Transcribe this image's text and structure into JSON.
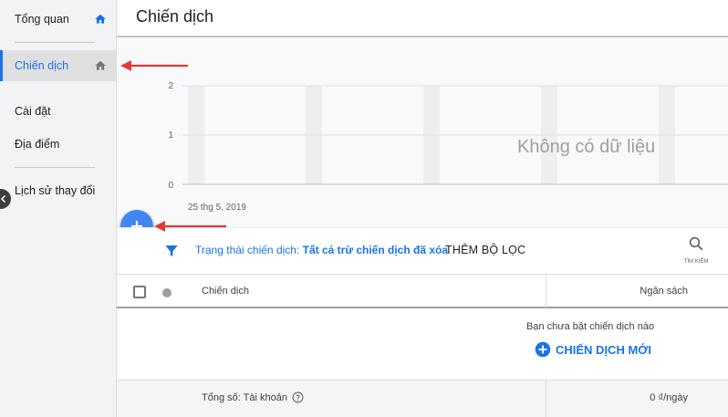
{
  "sidebar": {
    "items": [
      {
        "label": "Tổng quan",
        "icon": "home-icon"
      },
      {
        "label": "Chiến dịch",
        "icon": "home-icon",
        "active": true
      },
      {
        "label": "Cài đặt"
      },
      {
        "label": "Địa điểm"
      },
      {
        "label": "Lịch sử thay đổi"
      }
    ]
  },
  "header": {
    "title": "Chiến dịch"
  },
  "chart": {
    "y_ticks": [
      "2",
      "1",
      "0"
    ],
    "x_label": "25 thg 5, 2019",
    "no_data": "Không có dữ liệu"
  },
  "filter": {
    "label": "Trạng thái chiến dịch:",
    "value": "Tất cả trừ chiến dịch đã xóa",
    "add_filter": "THÊM BỘ LỌC",
    "search_label": "TÌM KIẾM"
  },
  "table": {
    "columns": [
      "Chiến dịch",
      "Ngân sách"
    ],
    "empty_message": "Bạn chưa bật chiến dịch nào",
    "new_campaign": "CHIẾN DỊCH MỚI",
    "totals_label": "Tổng số: Tài khoản",
    "totals_value": "0 ₫/ngày"
  },
  "colors": {
    "accent": "#1a73e8",
    "fab": "#4285f4",
    "annotation": "#e53935"
  }
}
